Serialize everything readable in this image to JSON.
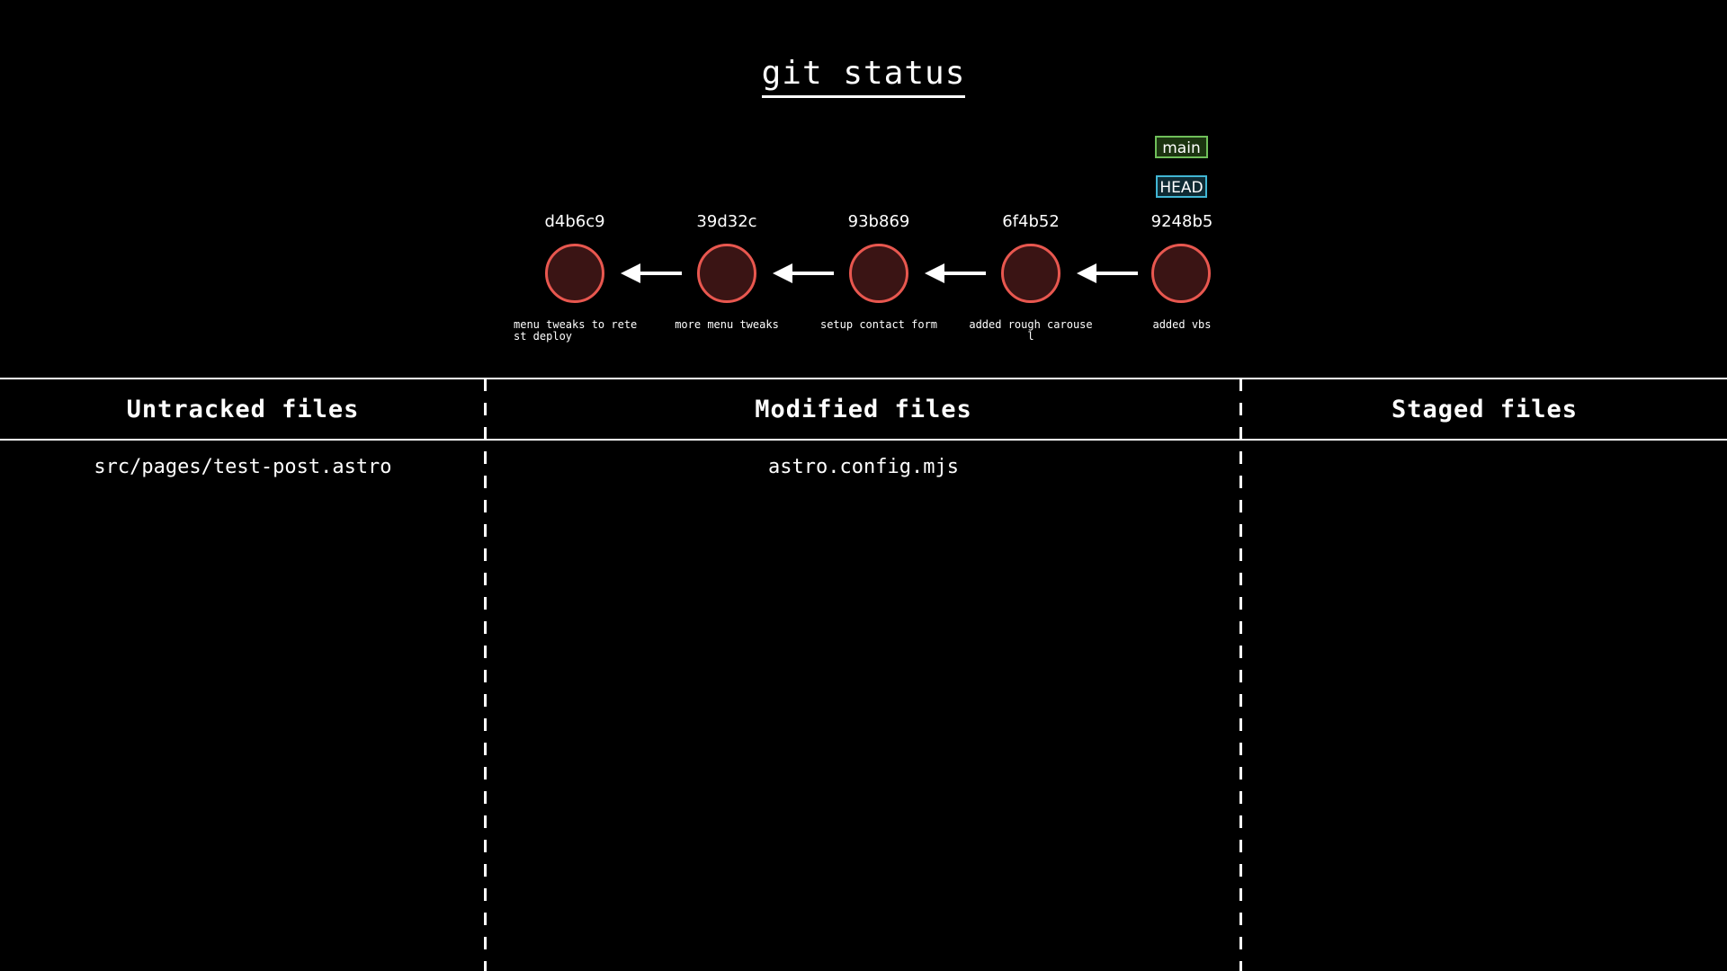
{
  "title": "git status",
  "colors": {
    "background": "#000000",
    "text": "#ffffff",
    "node_stroke": "#e8574f",
    "node_fill": "#3a1414",
    "main_border": "#6fbf5a",
    "main_fill": "#1b3310",
    "head_border": "#41b6d4",
    "head_fill": "#0f2a33"
  },
  "refs": {
    "main": "main",
    "head": "HEAD"
  },
  "commits": [
    {
      "hash": "d4b6c9",
      "message": "menu tweaks to retest deploy"
    },
    {
      "hash": "39d32c",
      "message": "more menu tweaks"
    },
    {
      "hash": "93b869",
      "message": "setup contact form"
    },
    {
      "hash": "6f4b52",
      "message": "added rough carousel"
    },
    {
      "hash": "9248b5",
      "message": "added vbs"
    }
  ],
  "areas": {
    "untracked": {
      "title": "Untracked files",
      "files": [
        "src/pages/test-post.astro"
      ]
    },
    "modified": {
      "title": "Modified files",
      "files": [
        "astro.config.mjs"
      ]
    },
    "staged": {
      "title": "Staged files",
      "files": []
    }
  }
}
